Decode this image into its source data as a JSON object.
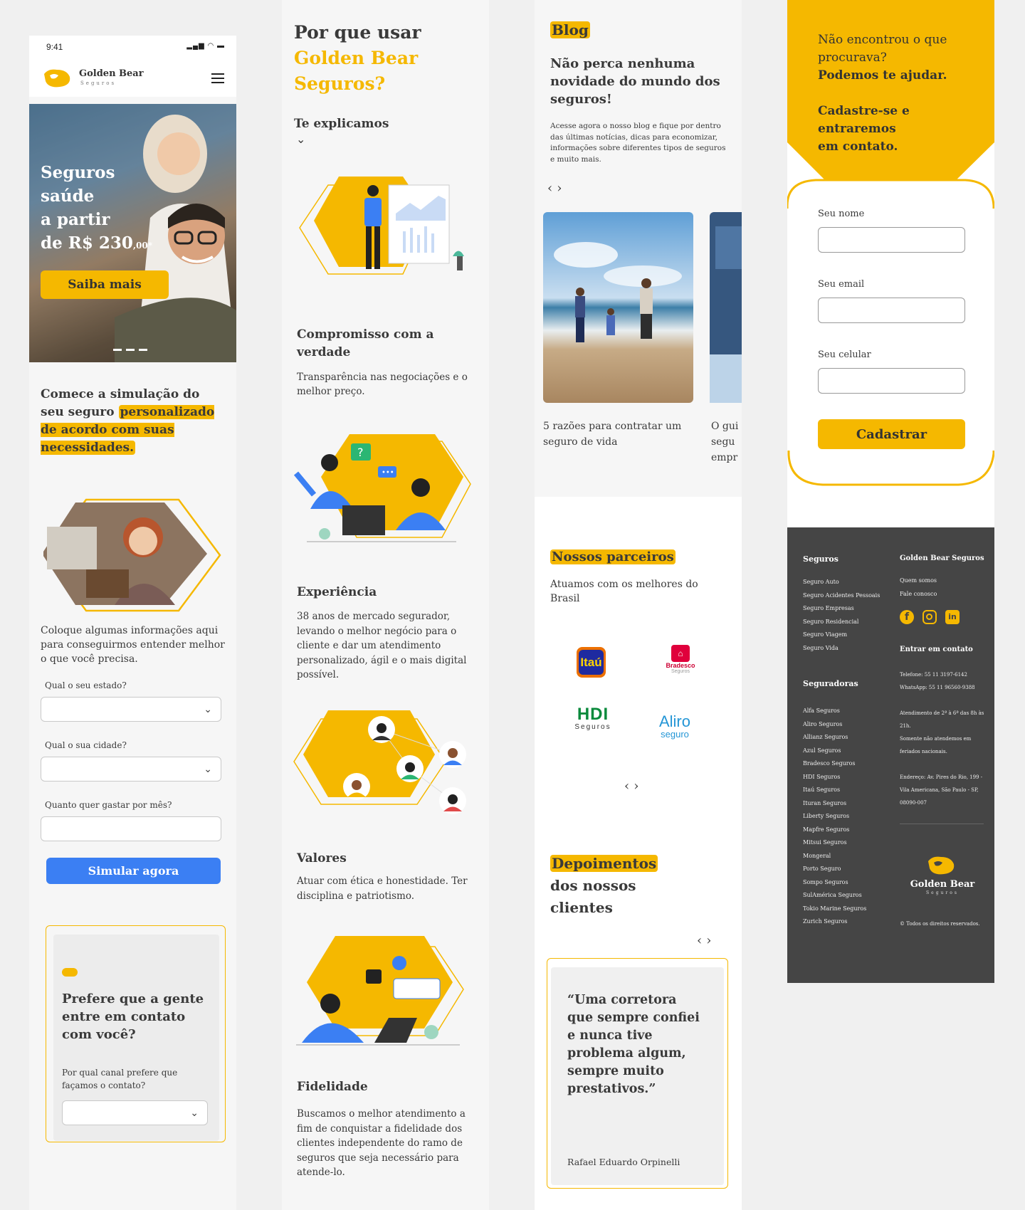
{
  "col1": {
    "status_time": "9:41",
    "brand_name": "Golden Bear",
    "brand_sub": "Seguros",
    "hero": {
      "line1": "Seguros",
      "line2": "saúde",
      "line3": "a partir",
      "line4_pre": "de R$ 230",
      "line4_cents": ",00*",
      "cta": "Saiba mais"
    },
    "sim_title": "Comece a simulação do seu seguro",
    "sim_title_hl": "personalizado de acordo com suas necessidades.",
    "sim_desc": "Coloque algumas informações aqui para conseguirmos entender melhor o que você precisa.",
    "field_state": "Qual o seu estado?",
    "field_city": "Qual o sua cidade?",
    "field_budget": "Quanto quer gastar por mês?",
    "sim_button": "Simular agora",
    "contact_title": "Prefere que a gente entre em contato com você?",
    "contact_label": "Por qual canal prefere que façamos o contato?"
  },
  "col2": {
    "title_a": "Por que usar",
    "title_b": "Golden Bear",
    "title_c": "Seguros?",
    "subtitle": "Te explicamos",
    "features": [
      {
        "title": "Compromisso com a verdade",
        "text": "Transparência nas negociações e o melhor preço."
      },
      {
        "title": "Experiência",
        "text": "38 anos de mercado segurador, levando o melhor negócio para o cliente e dar um atendimento personalizado, ágil e o mais digital possível."
      },
      {
        "title": "Valores",
        "text": "Atuar com ética e honestidade. Ter disciplina e patriotismo."
      },
      {
        "title": "Fidelidade",
        "text": "Buscamos o melhor atendimento a fim de conquistar a fidelidade dos clientes independente do ramo de seguros que seja necessário para atende-lo."
      }
    ]
  },
  "col3": {
    "blog_tag": "Blog",
    "blog_title": "Não perca nenhuma novidade do mundo dos seguros!",
    "blog_desc": "Acesse agora o nosso blog e fique por dentro das últimas notícias, dicas para economizar, informações sobre diferentes tipos de seguros e muito mais.",
    "post1": "5 razões para contratar um seguro de vida",
    "post2": "O gui segu empr",
    "partners_title": "Nossos parceiros",
    "partners_desc": "Atuamos com os melhores do Brasil",
    "partners": [
      "Itaú",
      "Bradesco",
      "Seguros",
      "HDI",
      "Seguros",
      "Aliro",
      "seguro"
    ],
    "testimonials_hl": "Depoimentos",
    "testimonials_rest": "dos nossos clientes",
    "quote": "“Uma corretora que sempre confiei e nunca tive problema algum, sempre muito prestativos.”",
    "quote_author": "Rafael Eduardo Orpinelli"
  },
  "col4": {
    "cta_line1": "Não encontrou o que procurava?",
    "cta_line2": "Podemos te ajudar.",
    "cta_line3": "Cadastre-se e entraremos em contato.",
    "label_name": "Seu nome",
    "label_email": "Seu email",
    "label_phone": "Seu celular",
    "submit": "Cadastrar",
    "footer": {
      "seguros_title": "Seguros",
      "seguros": [
        "Seguro Auto",
        "Seguro Acidentes Pessoais",
        "Seguro Empresas",
        "Seguro Residencial",
        "Seguro Viagem",
        "Seguro Vida"
      ],
      "seguradoras_title": "Seguradoras",
      "seguradoras": [
        "Alfa Seguros",
        "Aliro Seguros",
        "Allianz Seguros",
        "Azul Seguros",
        "Bradesco Seguros",
        "HDI Seguros",
        "Itaú Seguros",
        "Ituran Seguros",
        "Liberty Seguros",
        "Mapfre Seguros",
        "Mitsui Seguros",
        "Mongeral",
        "Porto Seguro",
        "Sompo Seguros",
        "SulAmérica Seguros",
        "Tokio Marine Seguros",
        "Zurich Seguros"
      ],
      "company_title": "Golden Bear Seguros",
      "company_links": [
        "Quem somos",
        "Fale conosco"
      ],
      "contact_title": "Entrar em contato",
      "phone": "Telefone: 55 11 3197-6142",
      "whatsapp": "WhatsApp: 55 11 96560-9388",
      "hours": "Atendimento de 2ª à 6ª das 8h às 21h.",
      "hours_note": "Somente não atendemos em feriados nacionais.",
      "address": "Endereço: Av. Pires do Rio, 199 - Vila Americana, São Paulo - SP, 08090-007",
      "brand": "Golden Bear",
      "brand_sub": "Seguros",
      "rights": "© Todos os direitos reservados."
    }
  },
  "colors": {
    "accent": "#f5b800",
    "blue": "#3b7ff3",
    "footer": "#454545"
  }
}
